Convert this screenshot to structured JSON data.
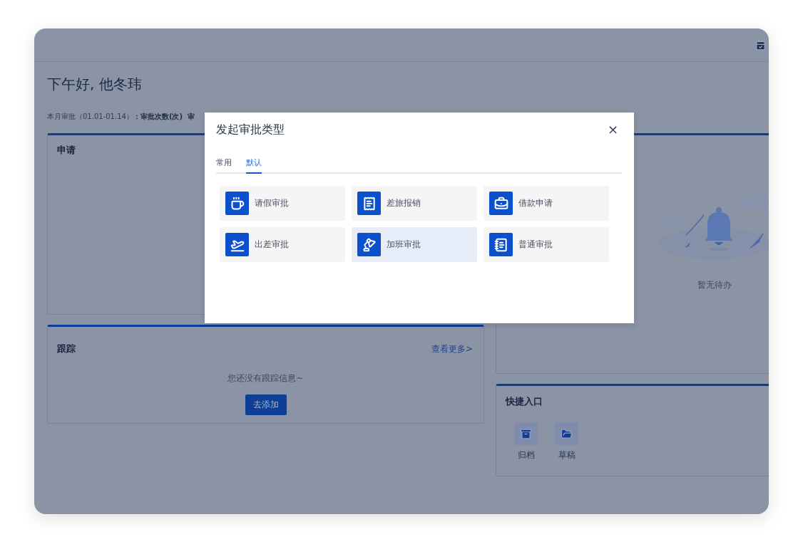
{
  "greeting": "下午好, 他冬玮",
  "stats": {
    "label": "本月审批（01.01-01.14）",
    "value": "：审批次数(次)",
    "next": "审"
  },
  "apply_card": {
    "title": "申请"
  },
  "track_card": {
    "title": "跟踪",
    "link": "查看更多>",
    "empty_text": "您还没有跟踪信息~",
    "button": "去添加"
  },
  "todo_card": {
    "empty_text": "暂无待办"
  },
  "shortcuts": {
    "title": "快捷入口",
    "items": [
      {
        "label": "归档",
        "kind": "archive"
      },
      {
        "label": "草稿",
        "kind": "folder"
      }
    ]
  },
  "dialog": {
    "title": "发起审批类型",
    "close": "×",
    "tabs": [
      {
        "label": "常用",
        "selected": false
      },
      {
        "label": "默认",
        "selected": true
      }
    ],
    "items": [
      {
        "label": "请假审批",
        "kind": "leave",
        "selected": false
      },
      {
        "label": "差旅报销",
        "kind": "expense",
        "selected": false
      },
      {
        "label": "借款申请",
        "kind": "loan",
        "selected": false
      },
      {
        "label": "出差审批",
        "kind": "trip",
        "selected": false
      },
      {
        "label": "加班审批",
        "kind": "overtime",
        "selected": true
      },
      {
        "label": "普通审批",
        "kind": "general",
        "selected": false
      }
    ]
  }
}
